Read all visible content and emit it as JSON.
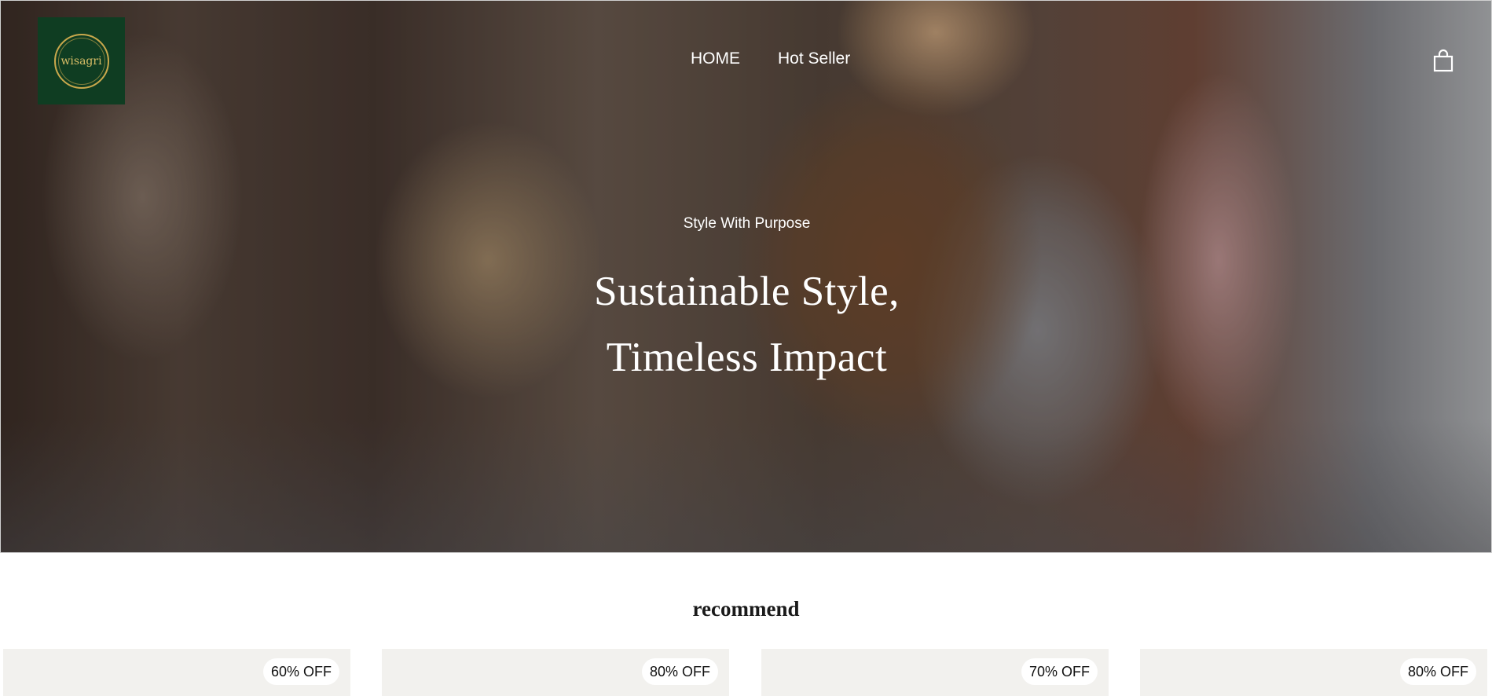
{
  "brand": {
    "logo_text": "wisagri",
    "logo_color": "#0f3d22",
    "logo_accent": "#c9a84c"
  },
  "nav": {
    "items": [
      {
        "label": "HOME"
      },
      {
        "label": "Hot Seller"
      }
    ],
    "cart_icon": "shopping-bag-icon"
  },
  "hero": {
    "eyebrow": "Style With Purpose",
    "headline_line1": "Sustainable Style,",
    "headline_line2": "Timeless Impact"
  },
  "recommend": {
    "title": "recommend",
    "products": [
      {
        "badge": "60% OFF"
      },
      {
        "badge": "80% OFF"
      },
      {
        "badge": "70% OFF"
      },
      {
        "badge": "80% OFF"
      }
    ]
  }
}
